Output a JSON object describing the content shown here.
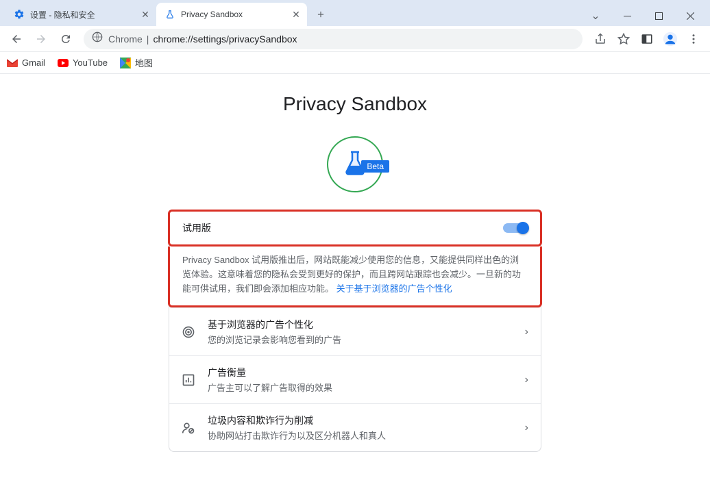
{
  "tabs": [
    {
      "title": "设置 - 隐私和安全"
    },
    {
      "title": "Privacy Sandbox"
    }
  ],
  "addressbar": {
    "origin": "Chrome",
    "separator": "|",
    "path": "chrome://settings/privacySandbox"
  },
  "bookmarks": [
    {
      "label": "Gmail"
    },
    {
      "label": "YouTube"
    },
    {
      "label": "地图"
    }
  ],
  "page": {
    "title": "Privacy Sandbox",
    "badge": "Beta",
    "trial_label": "试用版",
    "description": "Privacy Sandbox 试用版推出后，网站既能减少使用您的信息，又能提供同样出色的浏览体验。这意味着您的隐私会受到更好的保护，而且跨网站跟踪也会减少。一旦新的功能可供试用，我们即会添加相应功能。",
    "description_link": "关于基于浏览器的广告个性化",
    "rows": [
      {
        "title": "基于浏览器的广告个性化",
        "sub": "您的浏览记录会影响您看到的广告"
      },
      {
        "title": "广告衡量",
        "sub": "广告主可以了解广告取得的效果"
      },
      {
        "title": "垃圾内容和欺诈行为削减",
        "sub": "协助网站打击欺诈行为以及区分机器人和真人"
      }
    ]
  }
}
